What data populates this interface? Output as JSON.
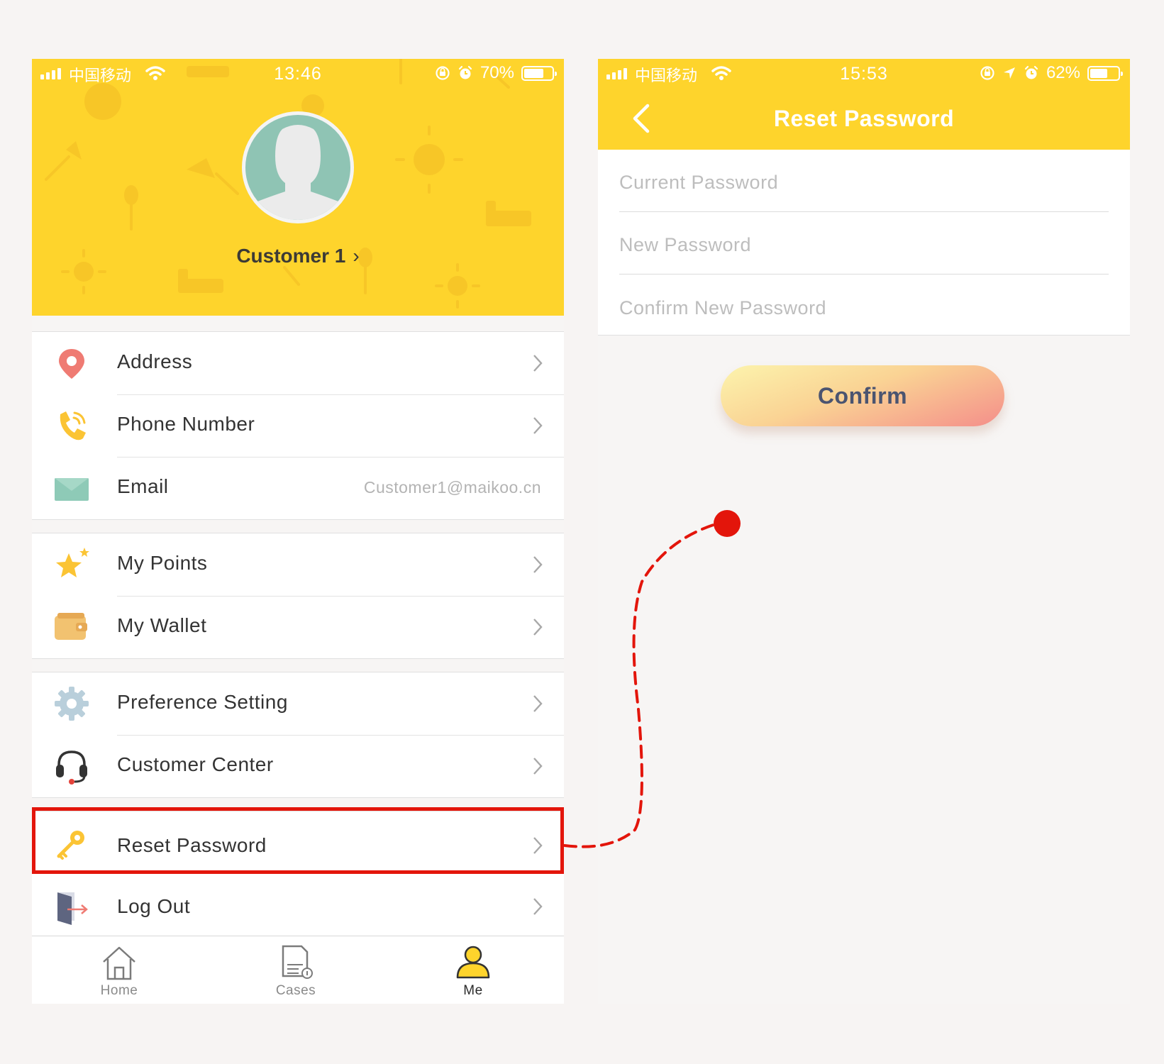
{
  "left_screen": {
    "status_bar": {
      "carrier": "中国移动",
      "time": "13:46",
      "battery_percent": "70%",
      "battery_level": 0.7
    },
    "profile": {
      "name": "Customer 1",
      "name_chevron": "›"
    },
    "menu_groups": [
      [
        {
          "label": "Address",
          "icon": "location-pin-icon",
          "chevron": true
        },
        {
          "label": "Phone Number",
          "icon": "phone-icon",
          "chevron": true
        },
        {
          "label": "Email",
          "icon": "envelope-icon",
          "value": "Customer1@maikoo.cn"
        }
      ],
      [
        {
          "label": "My Points",
          "icon": "star-icon",
          "chevron": true
        },
        {
          "label": "My Wallet",
          "icon": "wallet-icon",
          "chevron": true
        }
      ],
      [
        {
          "label": "Preference Setting",
          "icon": "gear-icon",
          "chevron": true
        },
        {
          "label": "Customer Center",
          "icon": "headset-icon",
          "chevron": true
        }
      ],
      [
        {
          "label": "Reset Password",
          "icon": "key-icon",
          "chevron": true,
          "highlighted": true
        },
        {
          "label": "Log Out",
          "icon": "logout-door-icon",
          "chevron": true
        }
      ]
    ],
    "tab_bar": [
      {
        "label": "Home",
        "icon": "home-icon",
        "active": false
      },
      {
        "label": "Cases",
        "icon": "document-icon",
        "active": false
      },
      {
        "label": "Me",
        "icon": "person-icon",
        "active": true
      }
    ]
  },
  "right_screen": {
    "status_bar": {
      "carrier": "中国移动",
      "time": "15:53",
      "battery_percent": "62%",
      "battery_level": 0.62
    },
    "nav": {
      "title": "Reset Password",
      "back_icon": "chevron-left-icon"
    },
    "form": {
      "current_password_placeholder": "Current Password",
      "new_password_placeholder": "New Password",
      "confirm_password_placeholder": "Confirm New Password"
    },
    "confirm_label": "Confirm"
  },
  "colors": {
    "brand_yellow": "#fed42c",
    "highlight_red": "#e3150b",
    "page_background": "#f7f4f3",
    "button_gradient": [
      "#fcf4ad",
      "#fad394",
      "#f48e8a"
    ],
    "button_text": "#4b5470"
  }
}
